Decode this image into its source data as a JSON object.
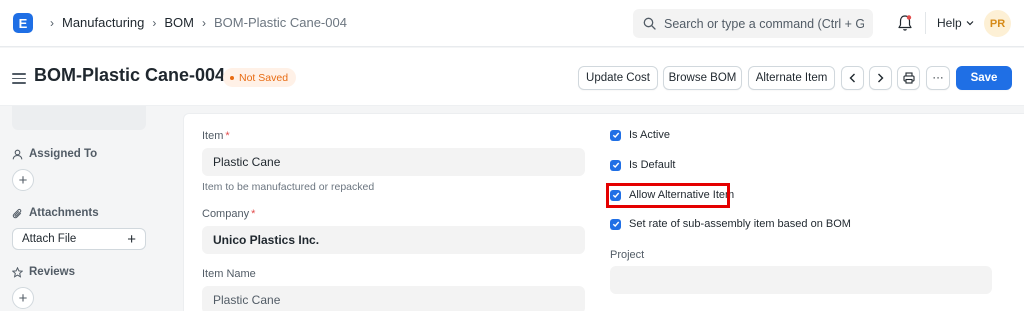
{
  "navbar": {
    "logo_letter": "E",
    "breadcrumbs": [
      "Manufacturing",
      "BOM",
      "BOM-Plastic Cane-004"
    ],
    "search_placeholder": "Search or type a command (Ctrl + G)",
    "help_label": "Help",
    "avatar_initials": "PR"
  },
  "page_head": {
    "title": "BOM-Plastic Cane-004",
    "status": "Not Saved",
    "buttons": {
      "update_cost": "Update Cost",
      "browse_bom": "Browse BOM",
      "alternate_item": "Alternate Item",
      "more": "···",
      "save": "Save"
    }
  },
  "sidebar": {
    "assigned_to": "Assigned To",
    "attachments": "Attachments",
    "attach_file": "Attach File",
    "reviews": "Reviews",
    "add_symbol": "+"
  },
  "form": {
    "item": {
      "label": "Item",
      "value": "Plastic Cane",
      "description": "Item to be manufactured or repacked"
    },
    "company": {
      "label": "Company",
      "value": "Unico Plastics Inc."
    },
    "item_name": {
      "label": "Item Name",
      "value": "Plastic Cane"
    },
    "required_mark": "*",
    "checks": {
      "is_active": "Is Active",
      "is_default": "Is Default",
      "allow_alternative_item": "Allow Alternative Item",
      "set_rate": "Set rate of sub-assembly item based on BOM"
    },
    "project": {
      "label": "Project",
      "value": ""
    }
  },
  "colors": {
    "primary": "#1f6fe5",
    "status_orange": "#e86c13",
    "highlight_red": "#e40000"
  }
}
